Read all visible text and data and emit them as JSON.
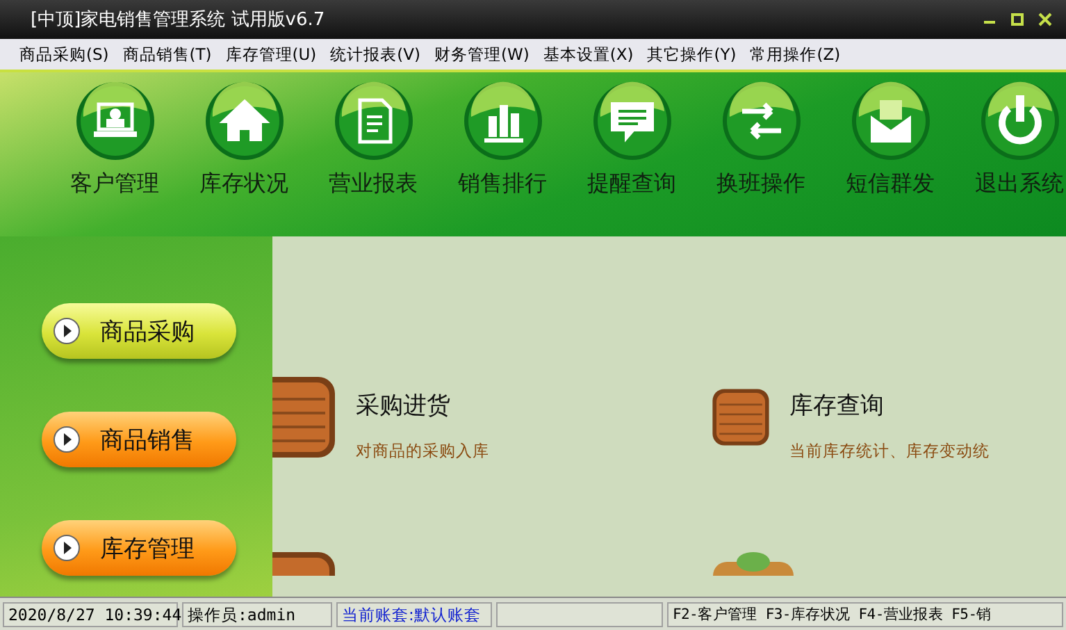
{
  "window": {
    "title": "[中顶]家电销售管理系统 试用版v6.7"
  },
  "menu": [
    "商品采购(S)",
    "商品销售(T)",
    "库存管理(U)",
    "统计报表(V)",
    "财务管理(W)",
    "基本设置(X)",
    "其它操作(Y)",
    "常用操作(Z)"
  ],
  "toolbar": [
    "客户管理",
    "库存状况",
    "营业报表",
    "销售排行",
    "提醒查询",
    "换班操作",
    "短信群发",
    "退出系统"
  ],
  "sidebar": [
    {
      "label": "商品采购",
      "selected": true
    },
    {
      "label": "商品销售",
      "selected": false
    },
    {
      "label": "库存管理",
      "selected": false
    }
  ],
  "modules": [
    {
      "title": "采购进货",
      "description": "对商品的采购入库"
    },
    {
      "title": "库存查询",
      "description": "当前库存统计、库存变动统"
    }
  ],
  "status_bar": [
    {
      "text": "2020/8/27 10:39:44",
      "kind": "plain"
    },
    {
      "text": "操作员:admin",
      "kind": "plain"
    },
    {
      "text": "当前账套:默认账套",
      "kind": "link"
    },
    {
      "text": "F2-客户管理 F3-库存状况 F4-营业报表 F5-销",
      "kind": "plain"
    }
  ]
}
